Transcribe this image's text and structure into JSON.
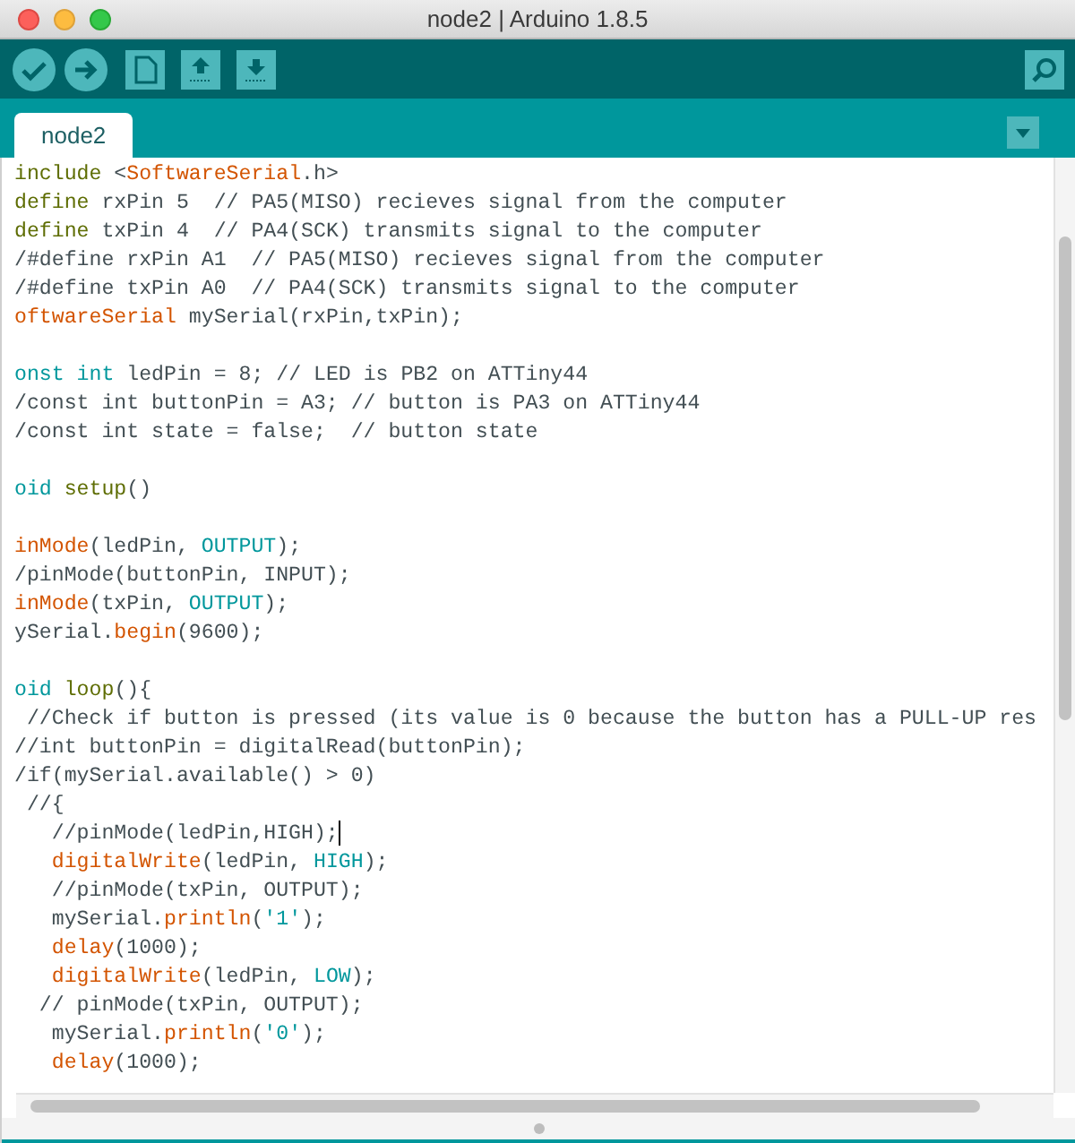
{
  "window": {
    "title": "node2 | Arduino 1.8.5"
  },
  "tabs": [
    {
      "label": "node2",
      "selected": true
    }
  ],
  "editor": {
    "lines": [
      {
        "kind": "code",
        "tokens": [
          {
            "kind": "keyword",
            "text": "include"
          },
          {
            "kind": "plain",
            "text": " <"
          },
          {
            "kind": "function",
            "text": "SoftwareSerial"
          },
          {
            "kind": "plain",
            "text": ".h>"
          }
        ]
      },
      {
        "kind": "code",
        "tokens": [
          {
            "kind": "keyword",
            "text": "define"
          },
          {
            "kind": "plain",
            "text": " rxPin 5  // PA5(MISO) recieves signal from the computer"
          }
        ]
      },
      {
        "kind": "code",
        "tokens": [
          {
            "kind": "keyword",
            "text": "define"
          },
          {
            "kind": "plain",
            "text": " txPin 4  // PA4(SCK) transmits signal to the computer"
          }
        ]
      },
      {
        "kind": "code",
        "tokens": [
          {
            "kind": "plain",
            "text": "/#define rxPin A1  // PA5(MISO) recieves signal from the computer"
          }
        ]
      },
      {
        "kind": "code",
        "tokens": [
          {
            "kind": "plain",
            "text": "/#define txPin A0  // PA4(SCK) transmits signal to the computer"
          }
        ]
      },
      {
        "kind": "code",
        "tokens": [
          {
            "kind": "function",
            "text": "oftwareSerial"
          },
          {
            "kind": "plain",
            "text": " mySerial(rxPin,txPin);"
          }
        ]
      },
      {
        "kind": "blank"
      },
      {
        "kind": "code",
        "tokens": [
          {
            "kind": "type",
            "text": "onst int"
          },
          {
            "kind": "plain",
            "text": " ledPin = 8; // LED is PB2 on ATTiny44"
          }
        ]
      },
      {
        "kind": "code",
        "tokens": [
          {
            "kind": "plain",
            "text": "/const int buttonPin = A3; // button is PA3 on ATTiny44"
          }
        ]
      },
      {
        "kind": "code",
        "tokens": [
          {
            "kind": "plain",
            "text": "/const int state = false;  // button state"
          }
        ]
      },
      {
        "kind": "blank"
      },
      {
        "kind": "code",
        "tokens": [
          {
            "kind": "type",
            "text": "oid "
          },
          {
            "kind": "keyword",
            "text": "setup"
          },
          {
            "kind": "plain",
            "text": "()"
          }
        ]
      },
      {
        "kind": "blank"
      },
      {
        "kind": "code",
        "tokens": [
          {
            "kind": "function",
            "text": "inMode"
          },
          {
            "kind": "plain",
            "text": "(ledPin, "
          },
          {
            "kind": "type",
            "text": "OUTPUT"
          },
          {
            "kind": "plain",
            "text": ");"
          }
        ]
      },
      {
        "kind": "code",
        "tokens": [
          {
            "kind": "plain",
            "text": "/pinMode(buttonPin, INPUT);"
          }
        ]
      },
      {
        "kind": "code",
        "tokens": [
          {
            "kind": "function",
            "text": "inMode"
          },
          {
            "kind": "plain",
            "text": "(txPin, "
          },
          {
            "kind": "type",
            "text": "OUTPUT"
          },
          {
            "kind": "plain",
            "text": ");"
          }
        ]
      },
      {
        "kind": "code",
        "tokens": [
          {
            "kind": "plain",
            "text": "ySerial."
          },
          {
            "kind": "function",
            "text": "begin"
          },
          {
            "kind": "plain",
            "text": "(9600);"
          }
        ]
      },
      {
        "kind": "blank"
      },
      {
        "kind": "code",
        "tokens": [
          {
            "kind": "type",
            "text": "oid "
          },
          {
            "kind": "keyword",
            "text": "loop"
          },
          {
            "kind": "plain",
            "text": "(){"
          }
        ]
      },
      {
        "kind": "code",
        "tokens": [
          {
            "kind": "plain",
            "text": " //Check if button is pressed (its value is 0 because the button has a PULL-UP res"
          }
        ]
      },
      {
        "kind": "code",
        "tokens": [
          {
            "kind": "plain",
            "text": "//int buttonPin = digitalRead(buttonPin);"
          }
        ]
      },
      {
        "kind": "code",
        "tokens": [
          {
            "kind": "plain",
            "text": "/if(mySerial.available() > 0)"
          }
        ]
      },
      {
        "kind": "code",
        "tokens": [
          {
            "kind": "plain",
            "text": " //{"
          }
        ]
      },
      {
        "kind": "code",
        "caret": true,
        "tokens": [
          {
            "kind": "plain",
            "text": "   //pinMode(ledPin,HIGH);"
          }
        ]
      },
      {
        "kind": "code",
        "tokens": [
          {
            "kind": "function",
            "text": "   digitalWrite"
          },
          {
            "kind": "plain",
            "text": "(ledPin, "
          },
          {
            "kind": "type",
            "text": "HIGH"
          },
          {
            "kind": "plain",
            "text": ");"
          }
        ]
      },
      {
        "kind": "code",
        "tokens": [
          {
            "kind": "plain",
            "text": "   //pinMode(txPin, OUTPUT);"
          }
        ]
      },
      {
        "kind": "code",
        "tokens": [
          {
            "kind": "plain",
            "text": "   mySerial."
          },
          {
            "kind": "function",
            "text": "println"
          },
          {
            "kind": "plain",
            "text": "("
          },
          {
            "kind": "type",
            "text": "'1'"
          },
          {
            "kind": "plain",
            "text": ");"
          }
        ]
      },
      {
        "kind": "code",
        "tokens": [
          {
            "kind": "function",
            "text": "   delay"
          },
          {
            "kind": "plain",
            "text": "(1000);"
          }
        ]
      },
      {
        "kind": "code",
        "tokens": [
          {
            "kind": "function",
            "text": "   digitalWrite"
          },
          {
            "kind": "plain",
            "text": "(ledPin, "
          },
          {
            "kind": "type",
            "text": "LOW"
          },
          {
            "kind": "plain",
            "text": ");"
          }
        ]
      },
      {
        "kind": "code",
        "tokens": [
          {
            "kind": "plain",
            "text": "  // pinMode(txPin, OUTPUT);"
          }
        ]
      },
      {
        "kind": "code",
        "tokens": [
          {
            "kind": "plain",
            "text": "   mySerial."
          },
          {
            "kind": "function",
            "text": "println"
          },
          {
            "kind": "plain",
            "text": "("
          },
          {
            "kind": "type",
            "text": "'0'"
          },
          {
            "kind": "plain",
            "text": ");"
          }
        ]
      },
      {
        "kind": "code",
        "tokens": [
          {
            "kind": "function",
            "text": "   delay"
          },
          {
            "kind": "plain",
            "text": "(1000);"
          }
        ]
      }
    ]
  }
}
